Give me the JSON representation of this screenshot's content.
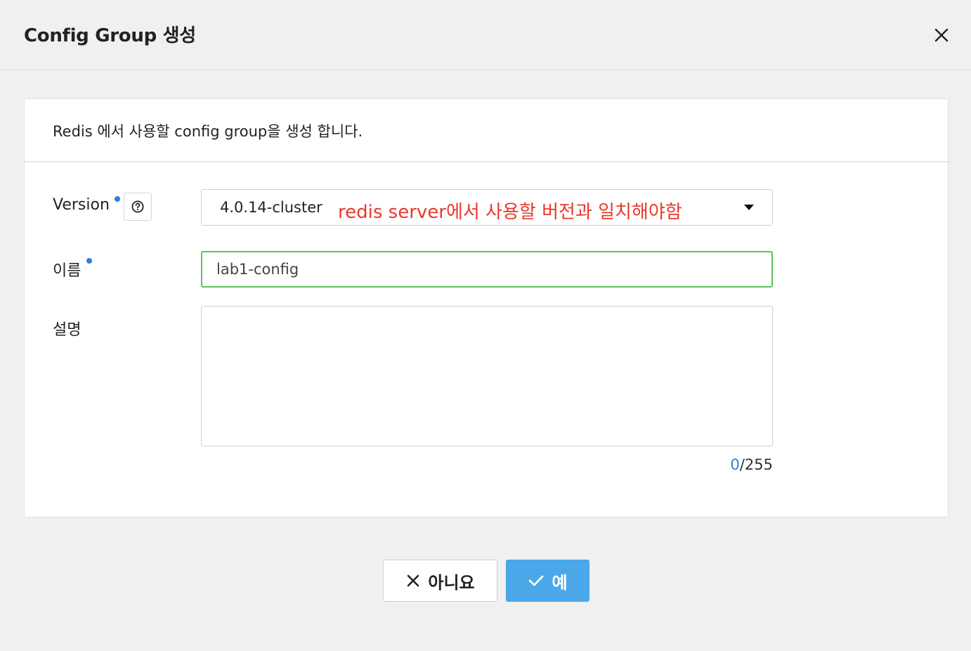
{
  "dialog": {
    "title": "Config Group 생성"
  },
  "panel": {
    "description": "Redis 에서 사용할 config group을 생성 합니다."
  },
  "form": {
    "version": {
      "label": "Version",
      "selected": "4.0.14-cluster",
      "annotation": "redis server에서 사용할 버전과 일치해야함"
    },
    "name": {
      "label": "이름",
      "value": "lab1-config"
    },
    "description": {
      "label": "설명",
      "value": "",
      "count": "0",
      "max": "/255"
    }
  },
  "buttons": {
    "no_label": "아니요",
    "yes_label": "예"
  },
  "colors": {
    "accent": "#2f7de1",
    "primary_button": "#4aa8e8",
    "valid_border": "#5cc15c",
    "annotation": "#e8392a"
  },
  "icons": [
    "close-icon",
    "help-icon",
    "caret-down-icon",
    "x-icon",
    "check-icon"
  ]
}
